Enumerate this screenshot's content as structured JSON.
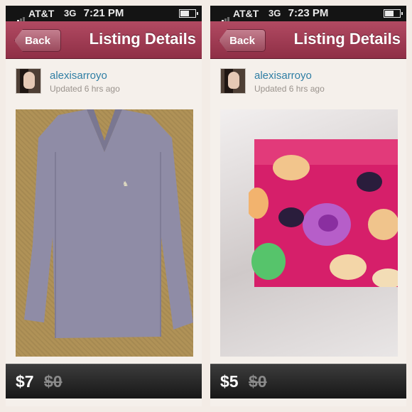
{
  "screens": [
    {
      "status": {
        "carrier": "AT&T",
        "network": "3G",
        "time": "7:21 PM"
      },
      "nav": {
        "back_label": "Back",
        "title": "Listing Details"
      },
      "seller": {
        "username": "alexisarroyo",
        "updated": "Updated 6 hrs ago"
      },
      "item": {
        "price": "$7",
        "original_price": "$0"
      }
    },
    {
      "status": {
        "carrier": "AT&T",
        "network": "3G",
        "time": "7:23 PM"
      },
      "nav": {
        "back_label": "Back",
        "title": "Listing Details"
      },
      "seller": {
        "username": "alexisarroyo",
        "updated": "Updated 6 hrs ago"
      },
      "item": {
        "price": "$5",
        "original_price": "$0"
      }
    }
  ],
  "colors": {
    "nav_bar": "#9c3a52",
    "username_link": "#2f7ea4",
    "price_bar": "#222222"
  }
}
